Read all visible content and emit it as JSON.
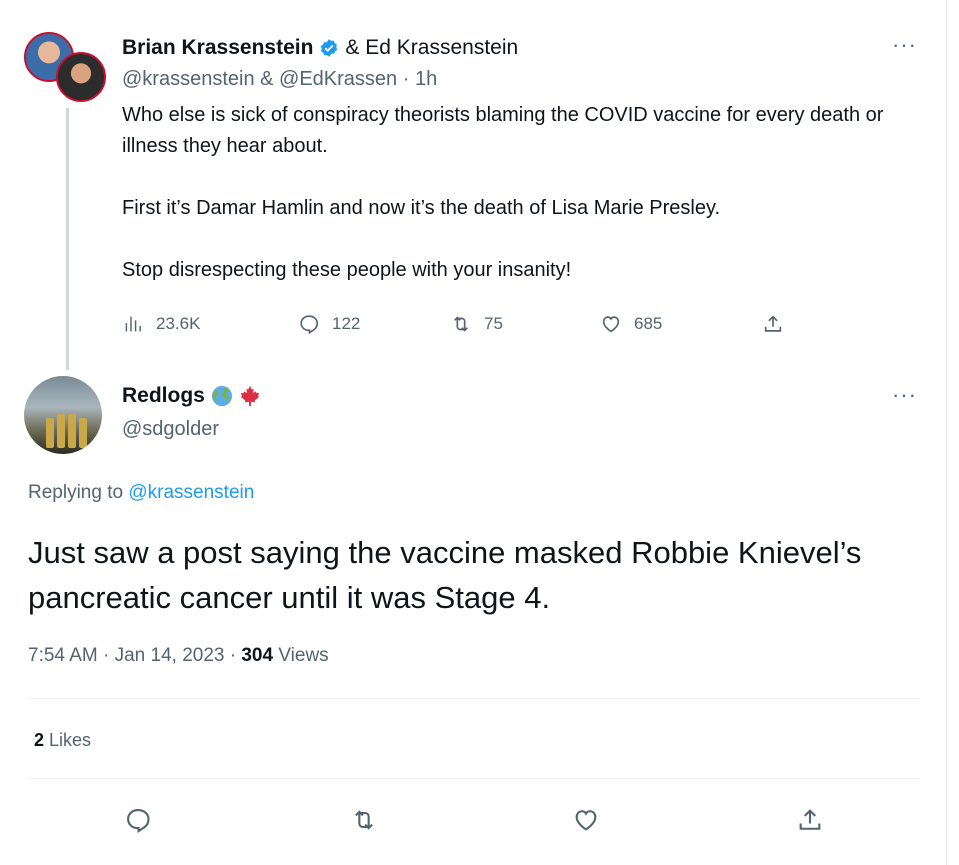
{
  "original_tweet": {
    "author1_name": "Brian Krassenstein",
    "joiner": "& Ed Krassenstein",
    "handles": "@krassenstein & @EdKrassen · 1h",
    "paragraphs": [
      "Who else is sick of conspiracy theorists blaming the COVID vaccine for every death or illness they hear about.",
      "First it’s Damar Hamlin and now it’s the death of Lisa Marie Presley.",
      "Stop disrespecting these people with your insanity!"
    ],
    "views": "23.6K",
    "replies": "122",
    "retweets": "75",
    "likes": "685",
    "more": "···"
  },
  "reply_tweet": {
    "name": "Redlogs",
    "handle": "@sdgolder",
    "replying_prefix": "Replying to",
    "replying_handle": "@krassenstein",
    "text": "Just saw a post saying the vaccine masked Robbie Knievel’s pancreatic cancer until it was Stage 4.",
    "timestamp": "7:54 AM · Jan 14, 2023 · ",
    "views_count": "304",
    "views_label": " Views",
    "likes_count": "2",
    "likes_label": " Likes",
    "more": "···"
  },
  "colors": {
    "text": "#0f1419",
    "secondary": "#536471",
    "link": "#1d9bf0",
    "divider": "#eff3f4"
  },
  "icons": [
    "verified-badge-icon",
    "views-icon",
    "reply-icon",
    "retweet-icon",
    "like-icon",
    "share-icon",
    "globe-emoji-icon",
    "maple-leaf-emoji-icon",
    "more-icon"
  ]
}
